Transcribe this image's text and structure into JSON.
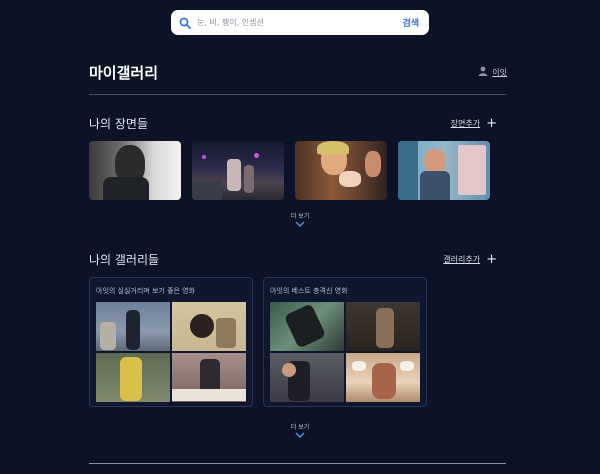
{
  "search": {
    "placeholder": "눈, 비, 팽이, 인셉션",
    "button_label": "검색"
  },
  "header": {
    "title": "마이갤러리",
    "user_label": "이잇"
  },
  "scenes_section": {
    "title": "나의 장면들",
    "add_label": "장면추가",
    "more_label": "더 보기"
  },
  "galleries_section": {
    "title": "나의 갤러리들",
    "add_label": "갤러리추가",
    "more_label": "더 보기",
    "items": [
      {
        "title": "아잇의 실실거리며 보기 좋은 영화"
      },
      {
        "title": "아잇의 베스트 충격신 영화"
      }
    ]
  },
  "next_section": {
    "title": ""
  },
  "colors": {
    "background": "#0c1327",
    "accent": "#2f6fdc",
    "divider": "#4a5068"
  },
  "icons": [
    "search-icon",
    "user-icon",
    "plus-icon",
    "chevron-down-icon"
  ]
}
